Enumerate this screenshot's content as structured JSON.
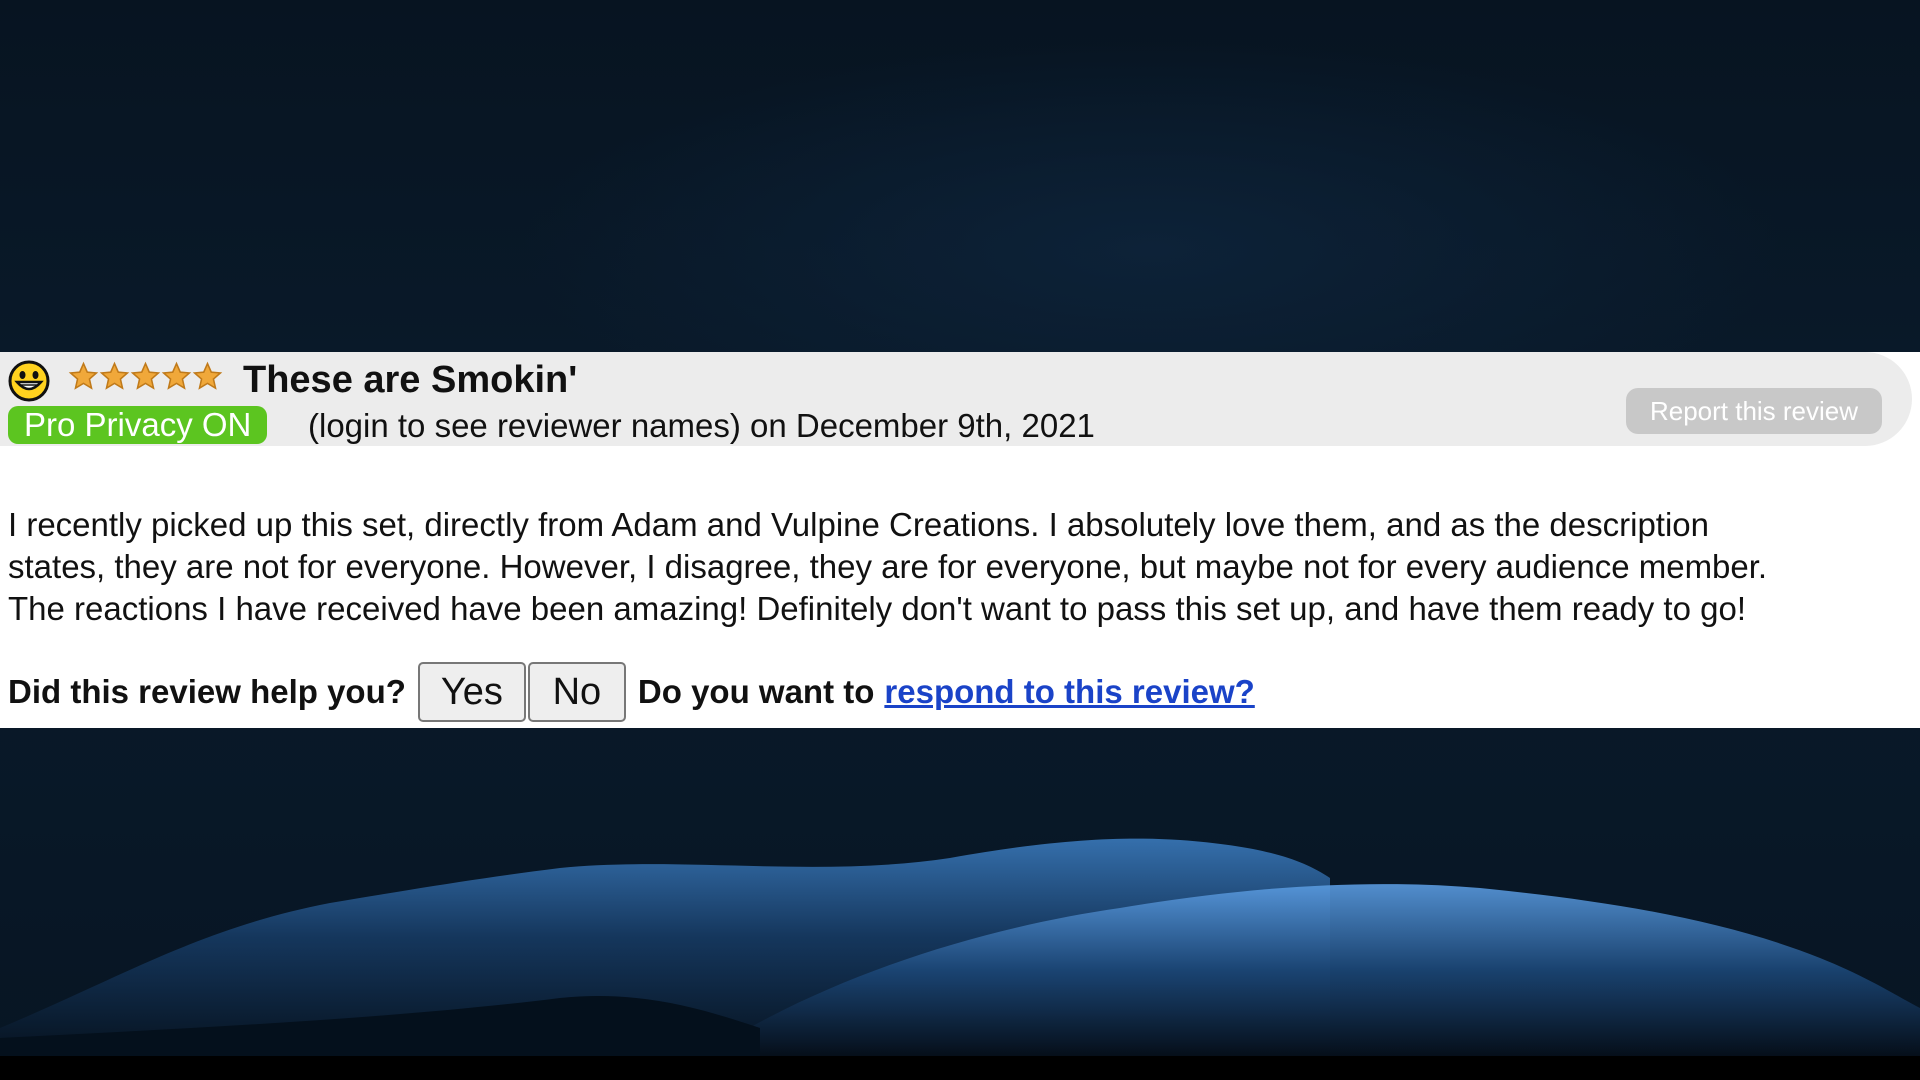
{
  "review": {
    "title": "These are Smokin'",
    "rating_stars": 5,
    "rating_max": 5,
    "privacy_badge": "Pro Privacy ON",
    "reviewer_line": "(login to see reviewer names) on December 9th, 2021",
    "report_button": "Report this review",
    "body_lines": [
      "I recently picked up this set, directly from Adam and Vulpine Creations. I absolutely love them, and as the description",
      "states, they are not for everyone. However, I disagree, they are for everyone, but maybe not for every audience member.",
      "The reactions I have received have been amazing! Definitely don't want to pass this set up, and have them ready to go!"
    ],
    "helpful_prompt": "Did this review help you?",
    "yes_label": "Yes",
    "no_label": "No",
    "respond_prompt": "Do you want to",
    "respond_link": "respond to this review?"
  },
  "icons": {
    "smiley": "smiley-face-icon",
    "star": "star-icon"
  },
  "colors": {
    "privacy_badge": "#5cc520",
    "link": "#1a43c8",
    "star": "#f0a83a",
    "header_bg": "#ececec",
    "report_button_bg": "#c8c8c8"
  }
}
